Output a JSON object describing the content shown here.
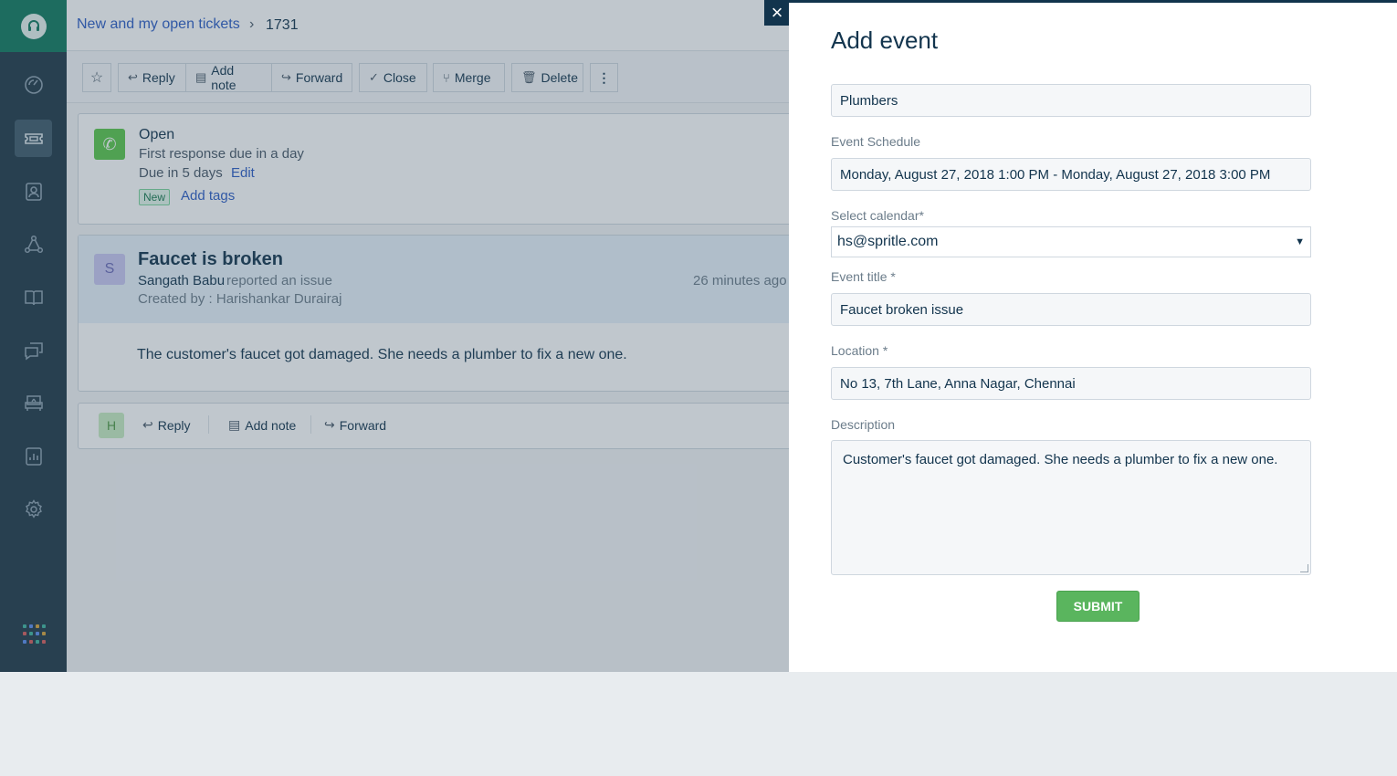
{
  "breadcrumb": {
    "link": "New and my open tickets",
    "separator": "›",
    "ticket_id": "1731"
  },
  "toolbar": {
    "reply": "Reply",
    "add_note": "Add note",
    "forward": "Forward",
    "close": "Close",
    "merge": "Merge",
    "delete": "Delete",
    "more": "⋮"
  },
  "status_card": {
    "status": "Open",
    "first_response": "First response due in a day",
    "due": "Due in 5 days",
    "edit": "Edit",
    "badge": "New",
    "add_tags": "Add tags"
  },
  "ticket": {
    "avatar_initial": "S",
    "title": "Faucet is broken",
    "reporter": "Sangath Babu",
    "reported_text": "reported an issue",
    "created_by": "Created by : Harishankar Durairaj",
    "time": "26 minutes ago",
    "body": "The customer's faucet got damaged. She needs a plumber to fix a new one."
  },
  "reply_bar": {
    "avatar_initial": "H",
    "reply": "Reply",
    "add_note": "Add note",
    "forward": "Forward"
  },
  "panel": {
    "close": "×",
    "title": "Add event",
    "search_value": "Plumbers",
    "schedule_label": "Event Schedule",
    "schedule_value": "Monday, August 27, 2018 1:00 PM - Monday, August 27, 2018 3:00 PM",
    "calendar_label": "Select calendar*",
    "calendar_value": "hs@spritle.com",
    "event_title_label": "Event title *",
    "event_title_value": "Faucet broken issue",
    "location_label": "Location *",
    "location_value": "No 13, 7th Lane, Anna Nagar, Chennai",
    "description_label": "Description",
    "description_value": "Customer's faucet got damaged. She needs a plumber to fix a new one.",
    "submit": "SUBMIT"
  },
  "colors": {
    "sidebar": "#1f3848",
    "brand": "#10795e",
    "link": "#2c5cc5",
    "submit": "#5ab55e",
    "status_green": "#5ac74b"
  },
  "icons": {
    "sidebar": [
      "dashboard-icon",
      "tickets-icon",
      "contacts-icon",
      "groups-icon",
      "solutions-icon",
      "forums-icon",
      "admin-icon",
      "reports-icon",
      "settings-icon"
    ]
  }
}
